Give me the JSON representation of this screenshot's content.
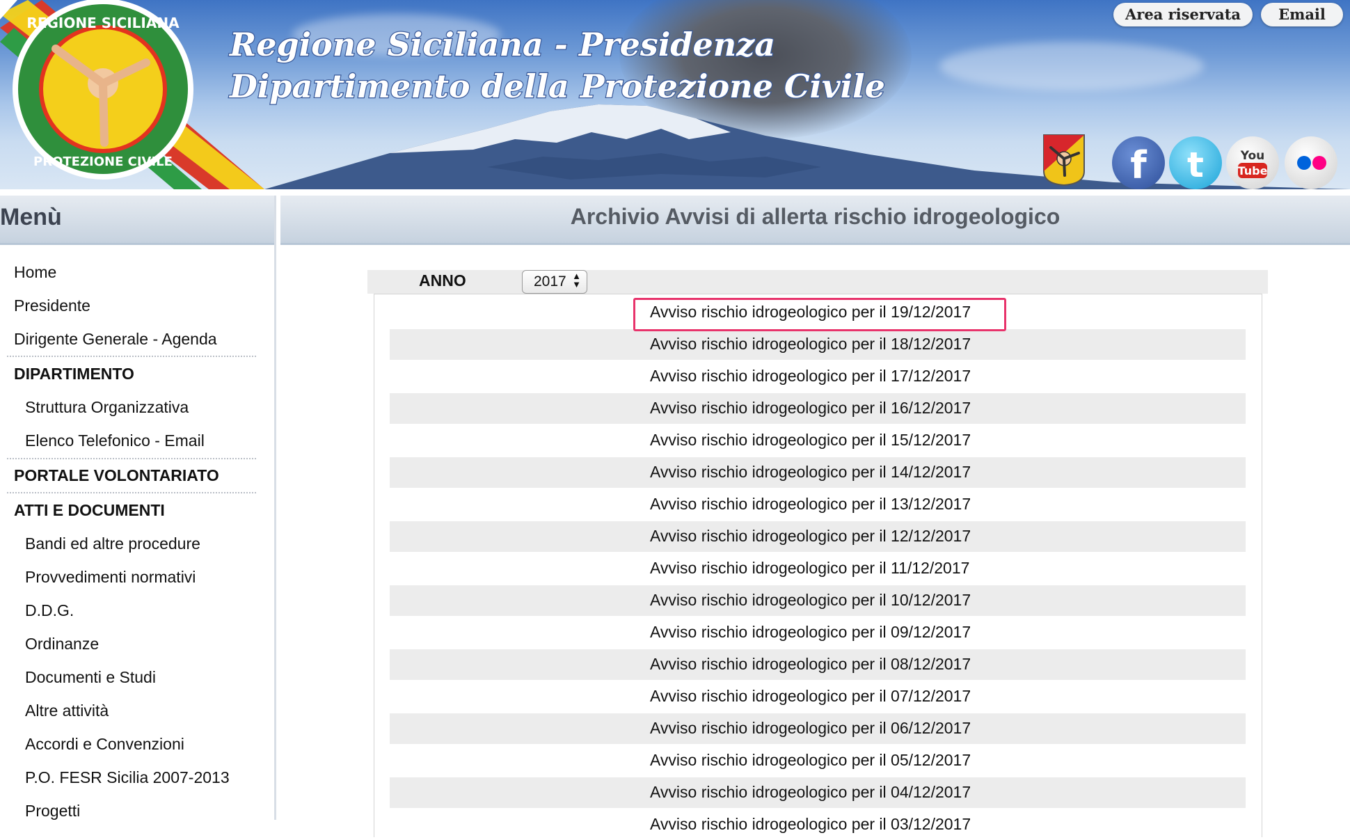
{
  "header": {
    "title_line1": "Regione Siciliana - Presidenza",
    "title_line2": "Dipartimento della Protezione Civile",
    "logo_text_top": "REGIONE SICILIANA",
    "logo_text_bottom": "PROTEZIONE CIVILE",
    "area_riservata": "Area riservata",
    "email": "Email",
    "youtube_you": "You",
    "youtube_tube": "Tube"
  },
  "sidebar": {
    "title": "Menù",
    "items": [
      {
        "label": "Home"
      },
      {
        "label": "Presidente"
      },
      {
        "label": "Dirigente Generale - Agenda"
      }
    ],
    "section_dipartimento": "DIPARTIMENTO",
    "dipartimento_items": [
      {
        "label": "Struttura Organizzativa"
      },
      {
        "label": "Elenco Telefonico - Email"
      }
    ],
    "section_volontariato": "PORTALE VOLONTARIATO",
    "section_atti": "ATTI E DOCUMENTI",
    "atti_items": [
      {
        "label": "Bandi ed altre procedure"
      },
      {
        "label": "Provvedimenti normativi"
      },
      {
        "label": "D.D.G."
      },
      {
        "label": "Ordinanze"
      },
      {
        "label": "Documenti e Studi"
      },
      {
        "label": "Altre attività"
      },
      {
        "label": "Accordi e Convenzioni"
      },
      {
        "label": "P.O. FESR Sicilia 2007-2013"
      },
      {
        "label": "Progetti"
      }
    ]
  },
  "main": {
    "title": "Archivio Avvisi di allerta rischio idrogeologico",
    "anno_label": "ANNO",
    "year_selected": "2017",
    "avvisi": [
      "Avviso rischio idrogeologico per il 19/12/2017",
      "Avviso rischio idrogeologico per il 18/12/2017",
      "Avviso rischio idrogeologico per il 17/12/2017",
      "Avviso rischio idrogeologico per il 16/12/2017",
      "Avviso rischio idrogeologico per il 15/12/2017",
      "Avviso rischio idrogeologico per il 14/12/2017",
      "Avviso rischio idrogeologico per il 13/12/2017",
      "Avviso rischio idrogeologico per il 12/12/2017",
      "Avviso rischio idrogeologico per il 11/12/2017",
      "Avviso rischio idrogeologico per il 10/12/2017",
      "Avviso rischio idrogeologico per il 09/12/2017",
      "Avviso rischio idrogeologico per il 08/12/2017",
      "Avviso rischio idrogeologico per il 07/12/2017",
      "Avviso rischio idrogeologico per il 06/12/2017",
      "Avviso rischio idrogeologico per il 05/12/2017",
      "Avviso rischio idrogeologico per il 04/12/2017",
      "Avviso rischio idrogeologico per il 03/12/2017"
    ],
    "highlight_color": "#e8336b"
  },
  "icons": [
    "sicily-flag-icon",
    "facebook-icon",
    "twitter-icon",
    "youtube-icon",
    "flickr-icon",
    "select-arrows-icon"
  ]
}
